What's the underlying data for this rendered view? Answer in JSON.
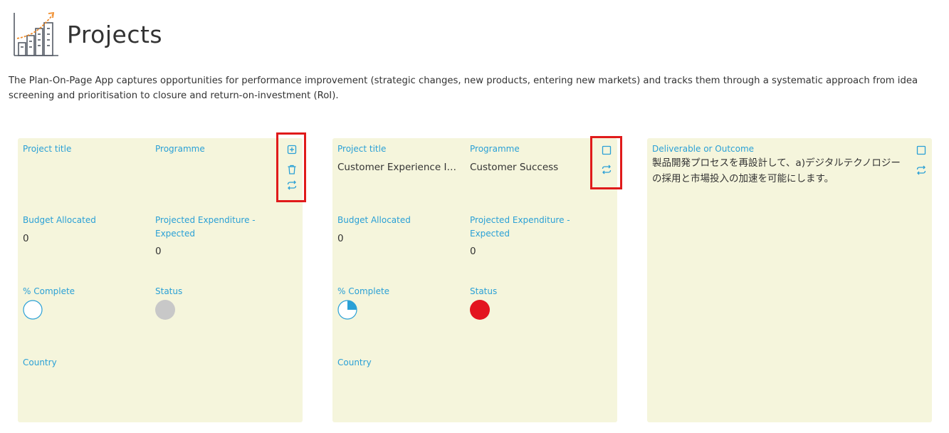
{
  "page": {
    "title": "Projects",
    "logo_icon": "growth-chart-buildings-icon",
    "intro": "The Plan-On-Page App captures opportunities for performance improvement (strategic changes, new products, entering new markets) and tracks them through a systematic approach from idea screening and prioritisation to closure and return-on-investment (RoI)."
  },
  "colors": {
    "card_bg": "#f5f5dc",
    "label": "#2aa0d6",
    "highlight": "#e01b1b",
    "status_grey": "#c8c8c8",
    "status_red": "#e3141f"
  },
  "cards": [
    {
      "labels": {
        "project_title": "Project title",
        "programme": "Programme",
        "budget": "Budget Allocated",
        "projected": "Projected Expenditure - Expected",
        "complete": "% Complete",
        "status": "Status",
        "country": "Country"
      },
      "values": {
        "project_title": "",
        "programme": "",
        "budget": "0",
        "projected": "0",
        "complete_fraction": 0,
        "status_color": "#c8c8c8",
        "country": ""
      },
      "icons": [
        "add-icon",
        "trash-icon",
        "refresh-icon"
      ]
    },
    {
      "labels": {
        "project_title": "Project title",
        "programme": "Programme",
        "budget": "Budget Allocated",
        "projected": "Projected Expenditure - Expected",
        "complete": "% Complete",
        "status": "Status",
        "country": "Country"
      },
      "values": {
        "project_title": "Customer Experience Im...",
        "programme": "Customer Success",
        "budget": "0",
        "projected": "0",
        "complete_fraction": 0.25,
        "status_color": "#e3141f",
        "country": ""
      },
      "icons": [
        "checkbox-icon",
        "refresh-icon"
      ]
    },
    {
      "labels": {
        "deliverable": "Deliverable or Outcome"
      },
      "values": {
        "deliverable": "製品開発プロセスを再設計して、a)デジタルテクノロジーの採用と市場投入の加速を可能にします。"
      },
      "icons": [
        "checkbox-icon",
        "refresh-icon"
      ]
    }
  ]
}
